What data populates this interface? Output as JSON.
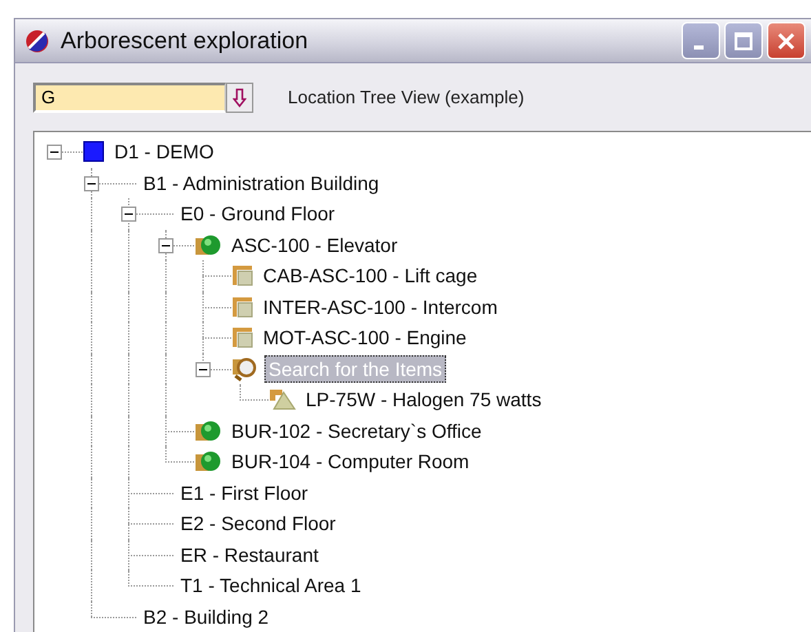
{
  "window": {
    "title": "Arborescent exploration"
  },
  "search": {
    "value": "G"
  },
  "caption": "Location Tree View (example)",
  "tree": [
    {
      "label": "D1 - DEMO",
      "kind": "site",
      "expanded": true,
      "selected": false,
      "children": [
        {
          "label": "B1 - Administration Building",
          "expanded": true,
          "selected": false,
          "children": [
            {
              "label": "E0 - Ground Floor",
              "expanded": true,
              "selected": false,
              "children": [
                {
                  "label": "ASC-100 - Elevator",
                  "kind": "equipment",
                  "expanded": true,
                  "selected": false,
                  "children": [
                    {
                      "label": "CAB-ASC-100 - Lift cage",
                      "kind": "component",
                      "selected": false
                    },
                    {
                      "label": "INTER-ASC-100 - Intercom",
                      "kind": "component",
                      "selected": false
                    },
                    {
                      "label": "MOT-ASC-100 - Engine",
                      "kind": "component",
                      "selected": false
                    },
                    {
                      "label": "Search for the Items",
                      "kind": "search",
                      "expanded": true,
                      "selected": true,
                      "children": [
                        {
                          "label": "LP-75W - Halogen 75 watts",
                          "kind": "lamp",
                          "selected": false
                        }
                      ]
                    }
                  ]
                },
                {
                  "label": "BUR-102 - Secretary`s Office",
                  "kind": "equipment",
                  "selected": false
                },
                {
                  "label": "BUR-104 - Computer Room",
                  "kind": "equipment",
                  "selected": false
                }
              ]
            },
            {
              "label": "E1 - First Floor",
              "selected": false
            },
            {
              "label": "E2 - Second Floor",
              "selected": false
            },
            {
              "label": "ER - Restaurant",
              "selected": false
            },
            {
              "label": "T1 - Technical Area 1",
              "selected": false
            }
          ]
        },
        {
          "label": "B2 - Building 2",
          "selected": false
        }
      ]
    }
  ]
}
